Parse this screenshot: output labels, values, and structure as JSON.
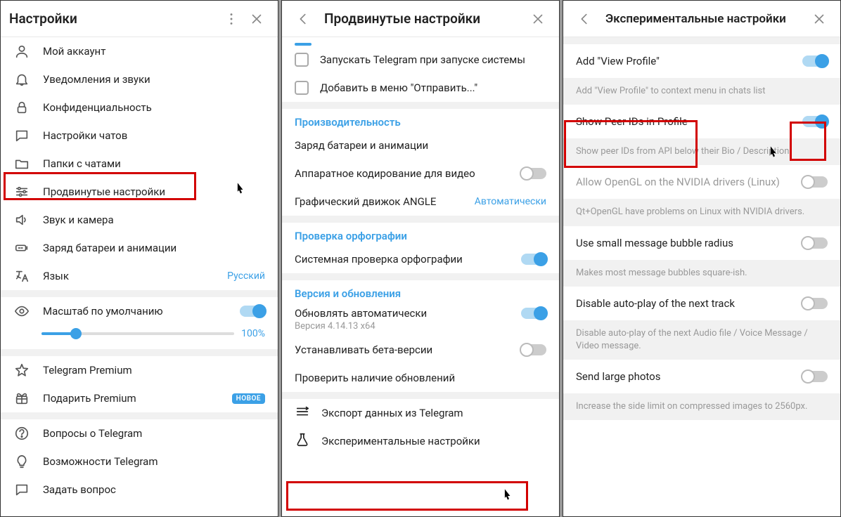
{
  "panel1": {
    "title": "Настройки",
    "items": [
      {
        "icon": "user-icon",
        "label": "Мой аккаунт"
      },
      {
        "icon": "bell-icon",
        "label": "Уведомления и звуки"
      },
      {
        "icon": "lock-icon",
        "label": "Конфиденциальность"
      },
      {
        "icon": "chat-icon",
        "label": "Настройки чатов"
      },
      {
        "icon": "folder-icon",
        "label": "Папки с чатами"
      },
      {
        "icon": "sliders-icon",
        "label": "Продвинутые настройки"
      },
      {
        "icon": "speaker-icon",
        "label": "Звук и камера"
      },
      {
        "icon": "battery-icon",
        "label": "Заряд батареи и анимации"
      },
      {
        "icon": "language-icon",
        "label": "Язык",
        "value": "Русский"
      }
    ],
    "scale_label": "Масштаб по умолчанию",
    "scale_value": "100%",
    "premium_label": "Telegram Premium",
    "gift_label": "Подарить Premium",
    "gift_badge": "НОВОЕ",
    "faq_label": "Вопросы о Telegram",
    "features_label": "Возможности Telegram",
    "ask_label": "Задать вопрос"
  },
  "panel2": {
    "title": "Продвинутые настройки",
    "check1": "Запускать Telegram при запуске системы",
    "check2": "Добавить в меню \"Отправить...\"",
    "sec_perf": "Производительность",
    "perf_battery": "Заряд батареи и анимации",
    "perf_hw": "Аппаратное кодирование для видео",
    "perf_angle": "Графический движок ANGLE",
    "perf_angle_value": "Автоматически",
    "sec_spell": "Проверка орфографии",
    "spell_sys": "Системная проверка орфографии",
    "sec_version": "Версия и обновления",
    "ver_auto": "Обновлять автоматически",
    "ver_sub": "Версия 4.14.13 x64",
    "ver_beta": "Устанавливать бета-версии",
    "ver_check": "Проверить наличие обновлений",
    "export_label": "Экспорт данных из Telegram",
    "experimental_label": "Экспериментальные настройки"
  },
  "panel3": {
    "title": "Экспериментальные настройки",
    "r1": {
      "label": "Add \"View Profile\"",
      "desc": "Add \"View Profile\" to context menu in chats list"
    },
    "r2": {
      "label": "Show Peer IDs in Profile",
      "desc": "Show peer IDs from API below their Bio / Description."
    },
    "r3": {
      "label": "Allow OpenGL on the NVIDIA drivers (Linux)",
      "desc": "Qt+OpenGL have problems on Linux with NVIDIA drivers."
    },
    "r4": {
      "label": "Use small message bubble radius",
      "desc": "Makes most message bubbles square-ish."
    },
    "r5": {
      "label": "Disable auto-play of the next track",
      "desc": "Disable auto-play of the next Audio file / Voice Message / Video message."
    },
    "r6": {
      "label": "Send large photos",
      "desc": "Increase the side limit on compressed images to 2560px."
    }
  }
}
